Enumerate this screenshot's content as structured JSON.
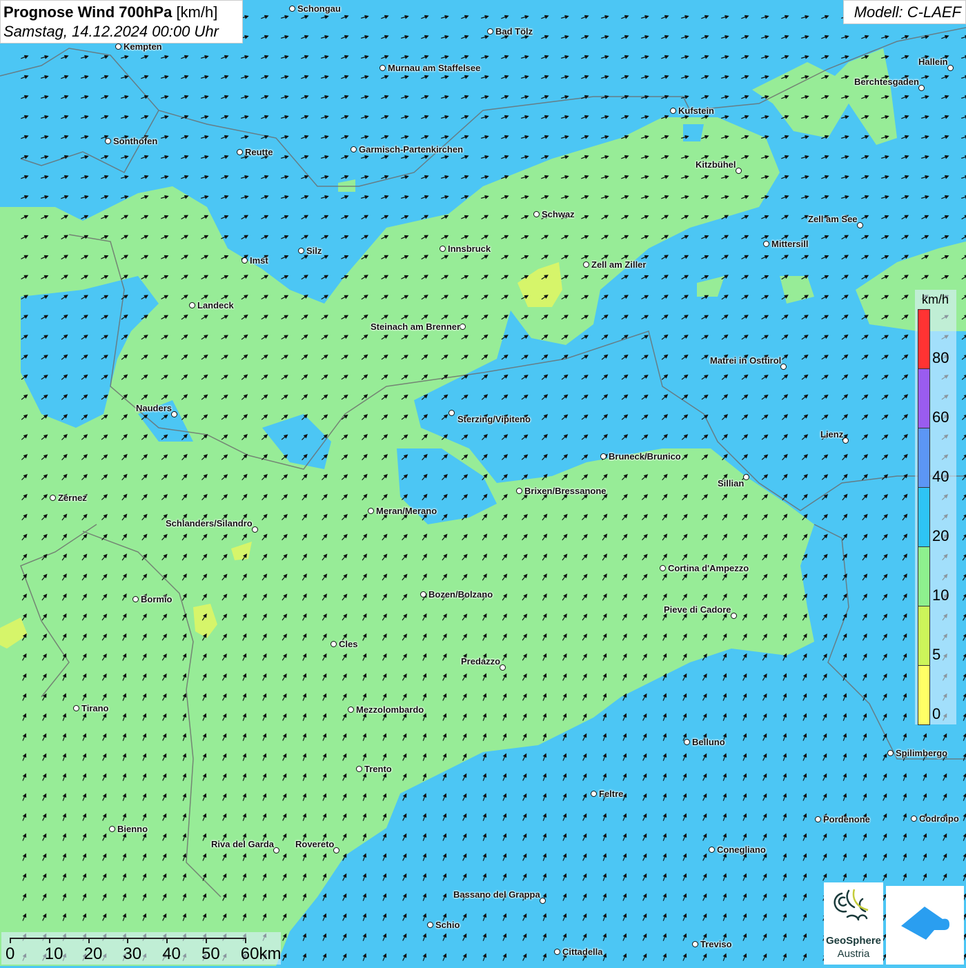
{
  "title": {
    "main": "Prognose Wind 700hPa",
    "unit": "[km/h]",
    "datetime": "Samstag, 14.12.2024 00:00 Uhr"
  },
  "model": "Modell: C-LAEF",
  "legend": {
    "unit": "km/h",
    "labels": [
      "80",
      "60",
      "40",
      "20",
      "10",
      "5",
      "0"
    ],
    "colors": [
      "#ff3333",
      "#9a5cf0",
      "#5c96f5",
      "#2ec4f5",
      "#8ef08e",
      "#ccf55a",
      "#ffff66"
    ]
  },
  "scale_bar": {
    "labels": [
      "0",
      "10",
      "20",
      "30",
      "40",
      "50",
      "60km"
    ]
  },
  "logos": {
    "geosphere_line1": "GeoSphere",
    "geosphere_line2": "Austria"
  },
  "colors": {
    "background_blue": "#4cc6f4",
    "field_green": "#97ec97",
    "field_yellow": "#d6f56a"
  },
  "cities": [
    "Schongau",
    "Bad Tölz",
    "Kempten",
    "Murnau am Staffelsee",
    "Hallein",
    "Berchtesgaden",
    "Kufstein",
    "Sonthofen",
    "Reutte",
    "Garmisch-Partenkirchen",
    "Kitzbühel",
    "Schwaz",
    "Zell am See",
    "Mittersill",
    "Innsbruck",
    "Imst",
    "Silz",
    "Zell am Ziller",
    "Landeck",
    "Steinach am Brenner",
    "Matrei in Osttirol",
    "Nauders",
    "Sterzing/Vipiteno",
    "Lienz",
    "Bruneck/Brunico",
    "Sillian",
    "Brixen/Bressanone",
    "Zernez",
    "Meran/Merano",
    "Schlanders/Silandro",
    "Cortina d'Ampezzo",
    "Bozen/Bolzano",
    "Bormio",
    "Pieve di Cadore",
    "Cles",
    "Predazzo",
    "Tirano",
    "Mezzolombardo",
    "Belluno",
    "Spilimbergo",
    "Trento",
    "Feltre",
    "Pordenone",
    "Codroipo",
    "Bienno",
    "Riva del Garda",
    "Rovereto",
    "Conegliano",
    "Bassano del Grappa",
    "Schio",
    "Treviso",
    "Cittadella"
  ]
}
